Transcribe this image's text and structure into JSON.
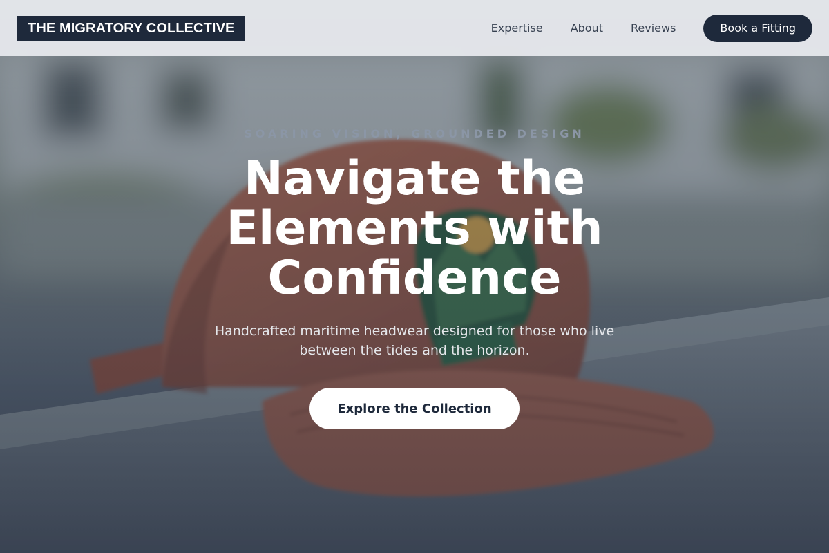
{
  "brand": {
    "name": "THE MIGRATORY COLLECTIVE"
  },
  "nav": {
    "items": [
      {
        "label": "Expertise"
      },
      {
        "label": "About"
      },
      {
        "label": "Reviews"
      }
    ],
    "cta_label": "Book a Fitting"
  },
  "hero": {
    "eyebrow": "SOARING VISION, GROUNDED DESIGN",
    "headline": "Navigate the Elements with Confidence",
    "subhead": "Handcrafted maritime headwear designed for those who live between the tides and the horizon.",
    "cta_label": "Explore the Collection"
  },
  "colors": {
    "brand_navy": "#1e293b",
    "header_bg": "#e5e7eb",
    "cap_rust": "#a8634e",
    "white": "#ffffff"
  }
}
